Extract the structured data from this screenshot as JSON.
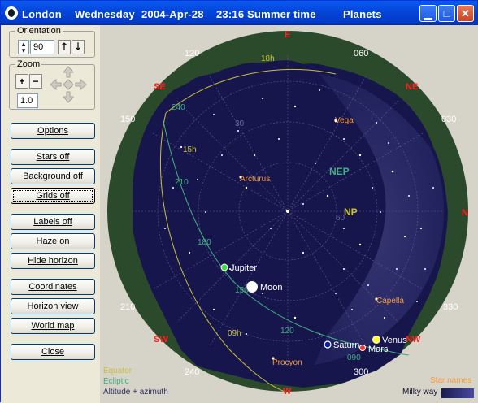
{
  "titlebar": {
    "location": "London",
    "day": "Wednesday",
    "date": "2004-Apr-28",
    "time": "23:16 Summer time",
    "mode": "Planets"
  },
  "orientation": {
    "label": "Orientation",
    "value": "90"
  },
  "zoom": {
    "label": "Zoom",
    "value": "1.0"
  },
  "buttons": {
    "options": "Options",
    "stars_off": "Stars off",
    "background_off": "Background off",
    "grids_off": "Grids off",
    "labels_off": "Labels off",
    "haze_on": "Haze on",
    "hide_horizon": "Hide horizon",
    "coordinates": "Coordinates",
    "horizon_view": "Horizon view",
    "world_map": "World map",
    "close": "Close"
  },
  "compass": {
    "n": "N",
    "e": "E",
    "w": "W",
    "se": "SE",
    "ne": "NE",
    "sw": "SW",
    "nw": "NW"
  },
  "azimuth_labels": [
    "120",
    "060",
    "150",
    "030",
    "210",
    "330",
    "240",
    "300"
  ],
  "ra_labels": {
    "r18": "18h",
    "r15": "15h",
    "r09": "09h"
  },
  "ecliptic_labels": {
    "e240": "240",
    "e210": "210",
    "e180": "180",
    "e150": "150",
    "e120": "120",
    "e090": "090"
  },
  "altitude_labels": {
    "a30": "30",
    "a60": "60"
  },
  "poles": {
    "nep": "NEP",
    "np": "NP"
  },
  "stars": {
    "vega": "Vega",
    "arcturus": "Arcturus",
    "capella": "Capella",
    "procyon": "Procyon"
  },
  "planets": {
    "jupiter": "Jupiter",
    "moon": "Moon",
    "saturn": "Saturn",
    "mars": "Mars",
    "venus": "Venus"
  },
  "legend": {
    "equator": "Equator",
    "ecliptic": "Ecliptic",
    "altaz": "Altitude + azimuth",
    "star_names": "Star names",
    "milky_way": "Milky way"
  },
  "colors": {
    "sky": "#141450",
    "horizon_ring": "#2b4a2b",
    "equator": "#c8c040",
    "ecliptic": "#40b080",
    "grid": "#6a6aa0",
    "compass": "#ff2020",
    "star_names": "#ff9a2a",
    "planets": "#ffffff"
  }
}
